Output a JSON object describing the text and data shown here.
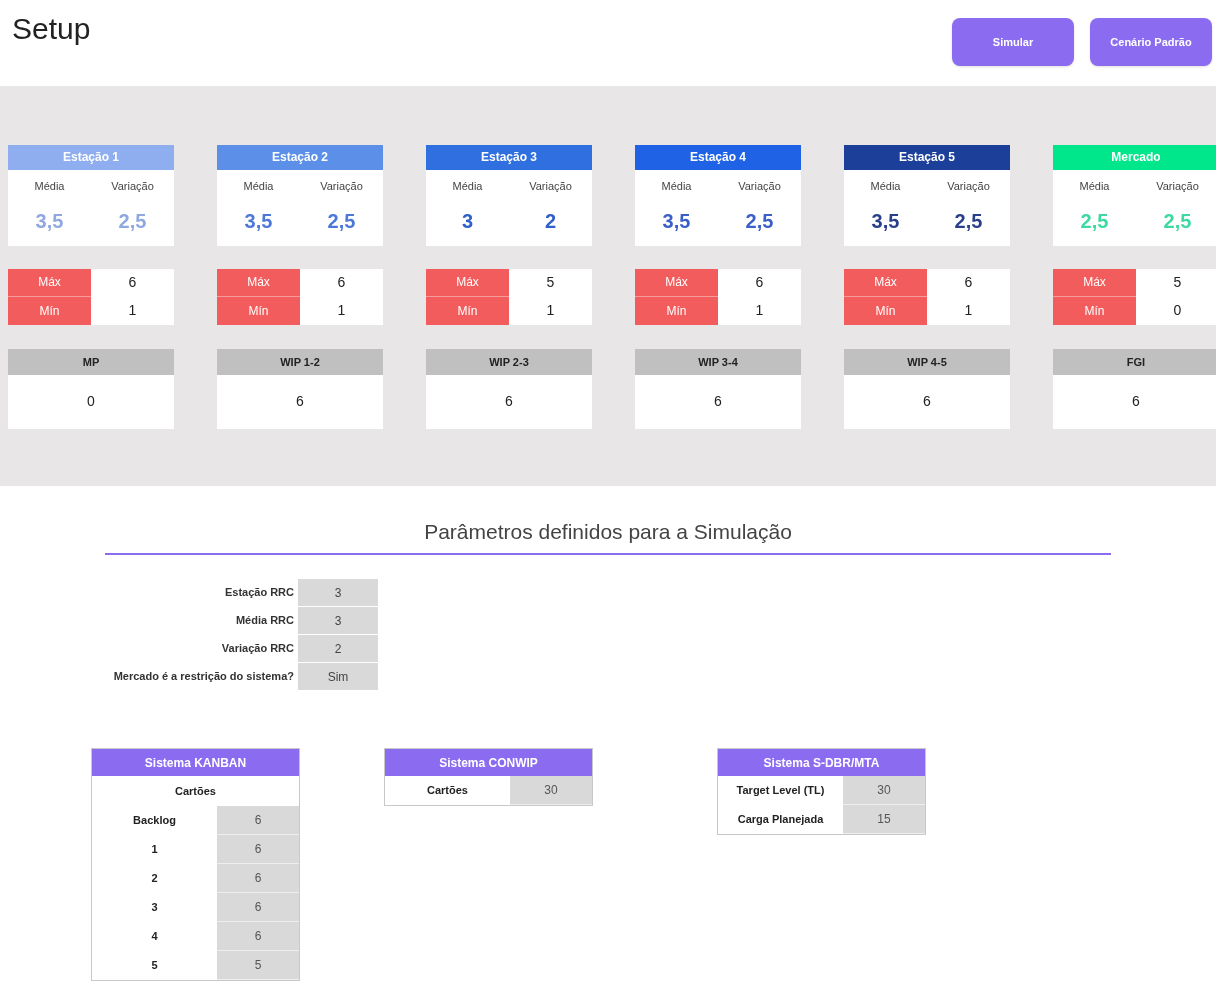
{
  "title": "Setup",
  "buttons": [
    {
      "label": "Simular"
    },
    {
      "label": "Cenário Padrão"
    }
  ],
  "stations": [
    {
      "name": "Estação 1",
      "color": "#8eaef0",
      "stats": [
        {
          "label": "Média",
          "value": "3,5",
          "color": "#8fa8e0"
        },
        {
          "label": "Variação",
          "value": "2,5",
          "color": "#8fa8e0"
        }
      ],
      "max_label": "Máx",
      "max": "6",
      "min_label": "Mín",
      "min": "1",
      "buffer_label": "MP",
      "buffer": "0"
    },
    {
      "name": "Estação 2",
      "color": "#5b8fe8",
      "stats": [
        {
          "label": "Média",
          "value": "3,5",
          "color": "#4d78d8"
        },
        {
          "label": "Variação",
          "value": "2,5",
          "color": "#4d78d8"
        }
      ],
      "max_label": "Máx",
      "max": "6",
      "min_label": "Mín",
      "min": "1",
      "buffer_label": "WIP 1-2",
      "buffer": "6"
    },
    {
      "name": "Estação 3",
      "color": "#2f6fe0",
      "stats": [
        {
          "label": "Média",
          "value": "3",
          "color": "#2f5fc8"
        },
        {
          "label": "Variação",
          "value": "2",
          "color": "#2f5fc8"
        }
      ],
      "max_label": "Máx",
      "max": "5",
      "min_label": "Mín",
      "min": "1",
      "buffer_label": "WIP 2-3",
      "buffer": "6"
    },
    {
      "name": "Estação 4",
      "color": "#1f62e6",
      "stats": [
        {
          "label": "Média",
          "value": "3,5",
          "color": "#3b5fc8"
        },
        {
          "label": "Variação",
          "value": "2,5",
          "color": "#3b5fc8"
        }
      ],
      "max_label": "Máx",
      "max": "6",
      "min_label": "Mín",
      "min": "1",
      "buffer_label": "WIP 3-4",
      "buffer": "6"
    },
    {
      "name": "Estação 5",
      "color": "#1c3f9a",
      "stats": [
        {
          "label": "Média",
          "value": "3,5",
          "color": "#2a3f8a"
        },
        {
          "label": "Variação",
          "value": "2,5",
          "color": "#2a3f8a"
        }
      ],
      "max_label": "Máx",
      "max": "6",
      "min_label": "Mín",
      "min": "1",
      "buffer_label": "WIP 4-5",
      "buffer": "6"
    },
    {
      "name": "Mercado",
      "color": "#00e68a",
      "stats": [
        {
          "label": "Média",
          "value": "2,5",
          "color": "#3dd9a0"
        },
        {
          "label": "Variação",
          "value": "2,5",
          "color": "#3dd9a0"
        }
      ],
      "max_label": "Máx",
      "max": "5",
      "min_label": "Mín",
      "min": "0",
      "buffer_label": "FGI",
      "buffer": "6"
    }
  ],
  "parameters": {
    "heading": "Parâmetros definidos para a Simulação",
    "rows": [
      {
        "label": "Estação RRC",
        "value": "3"
      },
      {
        "label": "Média RRC",
        "value": "3"
      },
      {
        "label": "Variação RRC",
        "value": "2"
      },
      {
        "label": "Mercado é a restrição do sistema?",
        "value": "Sim"
      }
    ]
  },
  "systems": [
    {
      "title": "Sistema KANBAN",
      "subtitle": "Cartões",
      "rows": [
        {
          "label": "Backlog",
          "value": "6"
        },
        {
          "label": "1",
          "value": "6"
        },
        {
          "label": "2",
          "value": "6"
        },
        {
          "label": "3",
          "value": "6"
        },
        {
          "label": "4",
          "value": "6"
        },
        {
          "label": "5",
          "value": "5"
        }
      ]
    },
    {
      "title": "Sistema CONWIP",
      "rows": [
        {
          "label": "Cartões",
          "value": "30"
        }
      ]
    },
    {
      "title": "Sistema S-DBR/MTA",
      "rows": [
        {
          "label": "Target Level (TL)",
          "value": "30"
        },
        {
          "label": "Carga Planejada",
          "value": "15"
        }
      ]
    }
  ]
}
